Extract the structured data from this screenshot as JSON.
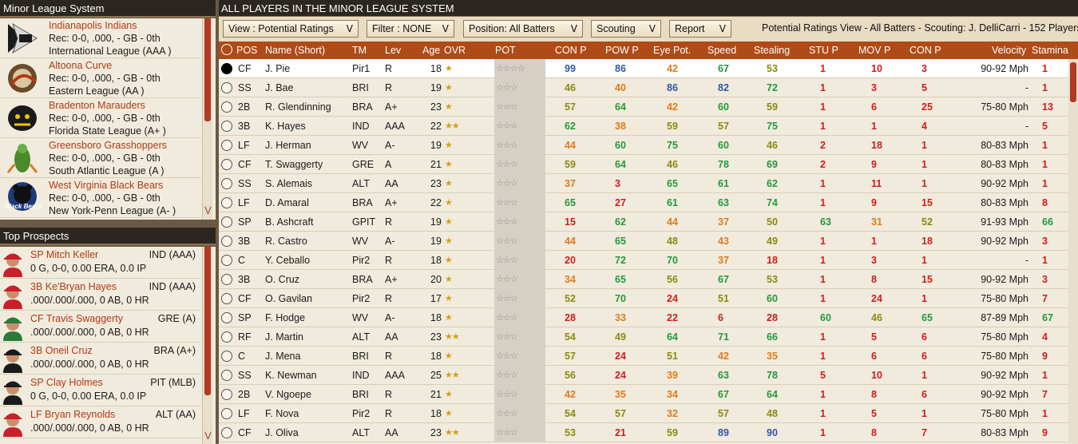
{
  "minor_league": {
    "title": "Minor League System",
    "teams": [
      {
        "name": "Indianapolis Indians",
        "rec": "Rec: 0-0, .000, - GB - 0th",
        "league": "International League (AAA )",
        "logo": "indians-logo"
      },
      {
        "name": "Altoona Curve",
        "rec": "Rec: 0-0, .000, - GB - 0th",
        "league": "Eastern League (AA )",
        "logo": "curve-logo"
      },
      {
        "name": "Bradenton Marauders",
        "rec": "Rec: 0-0, .000, - GB - 0th",
        "league": "Florida State League (A+ )",
        "logo": "marauders-logo"
      },
      {
        "name": "Greensboro Grasshoppers",
        "rec": "Rec: 0-0, .000, - GB - 0th",
        "league": "South Atlantic League (A )",
        "logo": "grasshoppers-logo"
      },
      {
        "name": "West Virginia Black Bears",
        "rec": "Rec: 0-0, .000, - GB - 0th",
        "league": "New York-Penn League (A- )",
        "logo": "blackbears-logo",
        "logo_text": "Black Bears"
      }
    ]
  },
  "top_prospects": {
    "title": "Top Prospects",
    "items": [
      {
        "name": "SP Mitch Keller",
        "team": "IND (AAA)",
        "line": "0 G, 0-0, 0.00 ERA, 0.0 IP",
        "jersey": "#c8202a"
      },
      {
        "name": "3B Ke'Bryan Hayes",
        "team": "IND (AAA)",
        "line": ".000/.000/.000, 0 AB, 0 HR",
        "jersey": "#c8202a"
      },
      {
        "name": "CF Travis Swaggerty",
        "team": "GRE (A)",
        "line": ".000/.000/.000, 0 AB, 0 HR",
        "jersey": "#2a7a3a"
      },
      {
        "name": "3B Oneil Cruz",
        "team": "BRA (A+)",
        "line": ".000/.000/.000, 0 AB, 0 HR",
        "jersey": "#1a1a1a"
      },
      {
        "name": "SP Clay Holmes",
        "team": "PIT (MLB)",
        "line": "0 G, 0-0, 0.00 ERA, 0.0 IP",
        "jersey": "#1a1a1a"
      },
      {
        "name": "LF Bryan Reynolds",
        "team": "ALT (AA)",
        "line": ".000/.000/.000, 0 AB, 0 HR",
        "jersey": "#c8202a"
      }
    ]
  },
  "main": {
    "title": "ALL PLAYERS IN THE MINOR LEAGUE SYSTEM",
    "toolbar": {
      "view": "View : Potential Ratings",
      "filter": "Filter : NONE",
      "position": "Position: All Batters",
      "scouting": "Scouting",
      "report": "Report",
      "info": "Potential Ratings View - All Batters - Scouting: J. DelliCarri - 152 Players"
    },
    "columns": {
      "pos": "POS",
      "name": "Name (Short)",
      "tm": "TM",
      "lev": "Lev",
      "age": "Age",
      "ovr": "OVR",
      "pot": "POT",
      "conp": "CON P",
      "powp": "POW P",
      "eye": "Eye Pot.",
      "speed": "Speed",
      "stealing": "Stealing",
      "stup": "STU P",
      "movp": "MOV P",
      "conp2": "CON P",
      "velocity": "Velocity",
      "stamina": "Stamina"
    },
    "rows": [
      {
        "pos": "CF",
        "name": "J. Pie",
        "tm": "Pir1",
        "lev": "R",
        "age": "18",
        "ovr": 1,
        "pot": 4,
        "conp": "99",
        "powp": "86",
        "eye": "42",
        "speed": "67",
        "steal": "53",
        "stup": "1",
        "movp": "10",
        "conp2": "3",
        "vel": "90-92 Mph",
        "stam": "1"
      },
      {
        "pos": "SS",
        "name": "J. Bae",
        "tm": "BRI",
        "lev": "R",
        "age": "19",
        "ovr": 1,
        "pot": 3,
        "conp": "46",
        "powp": "40",
        "eye": "86",
        "speed": "82",
        "steal": "72",
        "stup": "1",
        "movp": "3",
        "conp2": "5",
        "vel": "-",
        "stam": "1"
      },
      {
        "pos": "2B",
        "name": "R. Glendinning",
        "tm": "BRA",
        "lev": "A+",
        "age": "23",
        "ovr": 1,
        "pot": 3,
        "conp": "57",
        "powp": "64",
        "eye": "42",
        "speed": "60",
        "steal": "59",
        "stup": "1",
        "movp": "6",
        "conp2": "25",
        "vel": "75-80 Mph",
        "stam": "13"
      },
      {
        "pos": "3B",
        "name": "K. Hayes",
        "tm": "IND",
        "lev": "AAA",
        "age": "22",
        "ovr": 2,
        "pot": 3,
        "conp": "62",
        "powp": "38",
        "eye": "59",
        "speed": "57",
        "steal": "75",
        "stup": "1",
        "movp": "1",
        "conp2": "4",
        "vel": "-",
        "stam": "5"
      },
      {
        "pos": "LF",
        "name": "J. Herman",
        "tm": "WV",
        "lev": "A-",
        "age": "19",
        "ovr": 1,
        "pot": 3,
        "conp": "44",
        "powp": "60",
        "eye": "75",
        "speed": "60",
        "steal": "46",
        "stup": "2",
        "movp": "18",
        "conp2": "1",
        "vel": "80-83 Mph",
        "stam": "1"
      },
      {
        "pos": "CF",
        "name": "T. Swaggerty",
        "tm": "GRE",
        "lev": "A",
        "age": "21",
        "ovr": 1,
        "pot": 3,
        "conp": "59",
        "powp": "64",
        "eye": "46",
        "speed": "78",
        "steal": "69",
        "stup": "2",
        "movp": "9",
        "conp2": "1",
        "vel": "80-83 Mph",
        "stam": "1"
      },
      {
        "pos": "SS",
        "name": "S. Alemais",
        "tm": "ALT",
        "lev": "AA",
        "age": "23",
        "ovr": 1,
        "pot": 3,
        "conp": "37",
        "powp": "3",
        "eye": "65",
        "speed": "61",
        "steal": "62",
        "stup": "1",
        "movp": "11",
        "conp2": "1",
        "vel": "90-92 Mph",
        "stam": "1"
      },
      {
        "pos": "LF",
        "name": "D. Amaral",
        "tm": "BRA",
        "lev": "A+",
        "age": "22",
        "ovr": 1,
        "pot": 3,
        "conp": "65",
        "powp": "27",
        "eye": "61",
        "speed": "63",
        "steal": "74",
        "stup": "1",
        "movp": "9",
        "conp2": "15",
        "vel": "80-83 Mph",
        "stam": "8"
      },
      {
        "pos": "SP",
        "name": "B. Ashcraft",
        "tm": "GPIT",
        "lev": "R",
        "age": "19",
        "ovr": 1,
        "pot": 3,
        "conp": "15",
        "powp": "62",
        "eye": "44",
        "speed": "37",
        "steal": "50",
        "stup": "63",
        "movp": "31",
        "conp2": "52",
        "vel": "91-93 Mph",
        "stam": "66"
      },
      {
        "pos": "3B",
        "name": "R. Castro",
        "tm": "WV",
        "lev": "A-",
        "age": "19",
        "ovr": 1,
        "pot": 3,
        "conp": "44",
        "powp": "65",
        "eye": "48",
        "speed": "43",
        "steal": "49",
        "stup": "1",
        "movp": "1",
        "conp2": "18",
        "vel": "90-92 Mph",
        "stam": "3"
      },
      {
        "pos": "C",
        "name": "Y. Ceballo",
        "tm": "Pir2",
        "lev": "R",
        "age": "18",
        "ovr": 1,
        "pot": 3,
        "conp": "20",
        "powp": "72",
        "eye": "70",
        "speed": "37",
        "steal": "18",
        "stup": "1",
        "movp": "3",
        "conp2": "1",
        "vel": "-",
        "stam": "1"
      },
      {
        "pos": "3B",
        "name": "O. Cruz",
        "tm": "BRA",
        "lev": "A+",
        "age": "20",
        "ovr": 1,
        "pot": 3,
        "conp": "34",
        "powp": "65",
        "eye": "56",
        "speed": "67",
        "steal": "53",
        "stup": "1",
        "movp": "8",
        "conp2": "15",
        "vel": "90-92 Mph",
        "stam": "3"
      },
      {
        "pos": "CF",
        "name": "O. Gavilan",
        "tm": "Pir2",
        "lev": "R",
        "age": "17",
        "ovr": 1,
        "pot": 3,
        "conp": "52",
        "powp": "70",
        "eye": "24",
        "speed": "51",
        "steal": "60",
        "stup": "1",
        "movp": "24",
        "conp2": "1",
        "vel": "75-80 Mph",
        "stam": "7"
      },
      {
        "pos": "SP",
        "name": "F. Hodge",
        "tm": "WV",
        "lev": "A-",
        "age": "18",
        "ovr": 1,
        "pot": 3,
        "conp": "28",
        "powp": "33",
        "eye": "22",
        "speed": "6",
        "steal": "28",
        "stup": "60",
        "movp": "46",
        "conp2": "65",
        "vel": "87-89 Mph",
        "stam": "67"
      },
      {
        "pos": "RF",
        "name": "J. Martin",
        "tm": "ALT",
        "lev": "AA",
        "age": "23",
        "ovr": 2,
        "pot": 3,
        "conp": "54",
        "powp": "49",
        "eye": "64",
        "speed": "71",
        "steal": "66",
        "stup": "1",
        "movp": "5",
        "conp2": "6",
        "vel": "75-80 Mph",
        "stam": "4"
      },
      {
        "pos": "C",
        "name": "J. Mena",
        "tm": "BRI",
        "lev": "R",
        "age": "18",
        "ovr": 1,
        "pot": 3,
        "conp": "57",
        "powp": "24",
        "eye": "51",
        "speed": "42",
        "steal": "35",
        "stup": "1",
        "movp": "6",
        "conp2": "6",
        "vel": "75-80 Mph",
        "stam": "9"
      },
      {
        "pos": "SS",
        "name": "K. Newman",
        "tm": "IND",
        "lev": "AAA",
        "age": "25",
        "ovr": 2,
        "pot": 3,
        "conp": "56",
        "powp": "24",
        "eye": "39",
        "speed": "63",
        "steal": "78",
        "stup": "5",
        "movp": "10",
        "conp2": "1",
        "vel": "90-92 Mph",
        "stam": "1"
      },
      {
        "pos": "2B",
        "name": "V. Ngoepe",
        "tm": "BRI",
        "lev": "R",
        "age": "21",
        "ovr": 1,
        "pot": 3,
        "conp": "42",
        "powp": "35",
        "eye": "34",
        "speed": "67",
        "steal": "64",
        "stup": "1",
        "movp": "8",
        "conp2": "6",
        "vel": "90-92 Mph",
        "stam": "7"
      },
      {
        "pos": "LF",
        "name": "F. Nova",
        "tm": "Pir2",
        "lev": "R",
        "age": "18",
        "ovr": 1,
        "pot": 3,
        "conp": "54",
        "powp": "57",
        "eye": "32",
        "speed": "57",
        "steal": "48",
        "stup": "1",
        "movp": "5",
        "conp2": "1",
        "vel": "75-80 Mph",
        "stam": "1"
      },
      {
        "pos": "CF",
        "name": "J. Oliva",
        "tm": "ALT",
        "lev": "AA",
        "age": "23",
        "ovr": 2,
        "pot": 3,
        "conp": "53",
        "powp": "21",
        "eye": "59",
        "speed": "89",
        "steal": "90",
        "stup": "1",
        "movp": "8",
        "conp2": "7",
        "vel": "80-83 Mph",
        "stam": "9"
      }
    ]
  },
  "colors": {
    "header_bar": "#2c2620",
    "column_header": "#b04a16",
    "link_text": "#b03a14",
    "scroll_thumb": "#b23a22"
  }
}
